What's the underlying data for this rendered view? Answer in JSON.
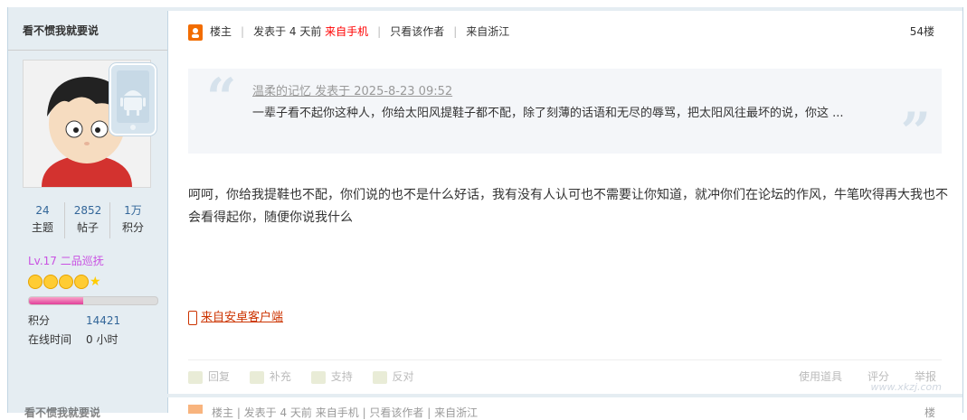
{
  "author": {
    "name": "看不惯我就要说",
    "stats": [
      {
        "num": "24",
        "label": "主题"
      },
      {
        "num": "2852",
        "label": "帖子"
      },
      {
        "num": "1万",
        "label": "积分"
      }
    ],
    "level": "Lv.17 二品巡抚",
    "level_progress": 0.42,
    "info": [
      {
        "key": "积分",
        "value": "14421"
      },
      {
        "key": "在线时间",
        "value": "0 小时"
      }
    ]
  },
  "post": {
    "owner_label": "楼主",
    "posted": "发表于 4 天前",
    "from_mobile": "来自手机",
    "only_author": "只看该作者",
    "location": "来自浙江",
    "floor": "54楼",
    "quote": {
      "header": "温柔的记忆 发表于 2025-8-23 09:52",
      "body": "一辈子看不起你这种人，你给太阳风提鞋子都不配，除了刻薄的话语和无尽的辱骂，把太阳风往最坏的说，你这 ..."
    },
    "body": "呵呵，你给我提鞋也不配，你们说的也不是什么好话，我有没有人认可也不需要让你知道，就冲你们在论坛的作风，牛笔吹得再大我也不会看得起你，随便你说我什么",
    "from_app": "来自安卓客户端",
    "actions": [
      "回复",
      "补充",
      "支持",
      "反对"
    ],
    "actions_right": [
      "使用道具",
      "评分",
      "举报"
    ]
  },
  "next": {
    "user": "看不惯我就要说",
    "meta": "楼主 | 发表于 4 天前 来自手机 | 只看该作者 | 来自浙江",
    "floor": "楼"
  },
  "watermark": "www.xkzj.com",
  "colors": {
    "sidebar_bg": "#e5edf2",
    "border": "#c2d5e3",
    "link": "#336699",
    "level": "#c951e2",
    "mobile_red": "#ff0000",
    "app_link": "#cc3300"
  }
}
